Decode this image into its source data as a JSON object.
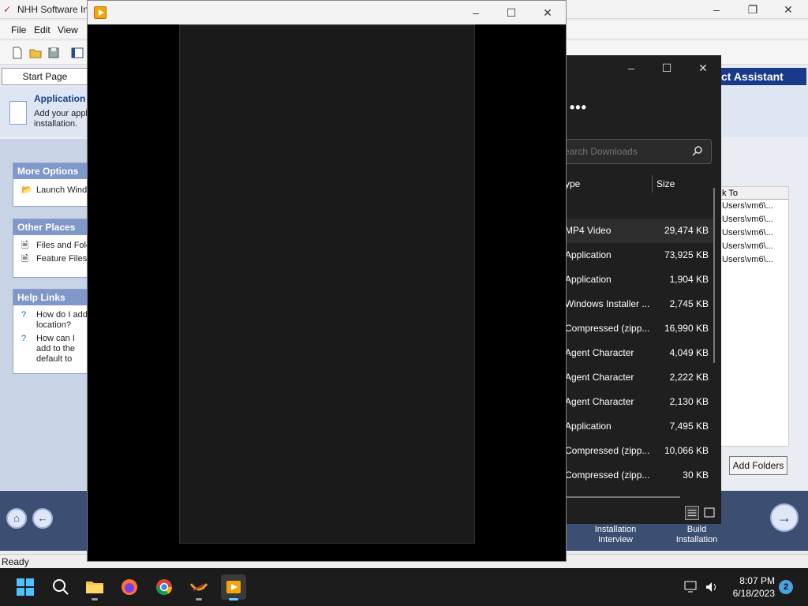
{
  "installer": {
    "title": "NHH Software In",
    "menu": [
      "File",
      "Edit",
      "View"
    ],
    "start_page_tab": "Start Page",
    "heading": "Application",
    "description": "Add your appl installation.",
    "right_title": "ct Assistant",
    "more_options": {
      "title": "More Options",
      "items": [
        "Launch Windo"
      ]
    },
    "other_places": {
      "title": "Other Places",
      "items": [
        "Files and Fold",
        "Feature Files"
      ]
    },
    "help_links": {
      "title": "Help Links",
      "items": [
        "How do I add location?",
        "How can I add to the default to me?"
      ]
    },
    "list": {
      "column": "k To",
      "rows": [
        "Users\\vm6\\...",
        "Users\\vm6\\...",
        "Users\\vm6\\...",
        "Users\\vm6\\...",
        "Users\\vm6\\..."
      ]
    },
    "add_folders": "Add Folders",
    "nav": {
      "installation_interview": "Installation Interview",
      "build_installation": "Build Installation"
    },
    "status": "Ready"
  },
  "explorer": {
    "more_label": "•••",
    "search_placeholder": "earch Downloads",
    "columns": {
      "type": "ype",
      "size": "Size"
    },
    "files": [
      {
        "type": "MP4 Video",
        "size": "29,474 KB",
        "selected": true
      },
      {
        "type": "Application",
        "size": "73,925 KB"
      },
      {
        "type": "Application",
        "size": "1,904 KB"
      },
      {
        "type": "Windows Installer ...",
        "size": "2,745 KB"
      },
      {
        "type": "Compressed (zipp...",
        "size": "16,990 KB"
      },
      {
        "type": "Agent Character",
        "size": "4,049 KB"
      },
      {
        "type": "Agent Character",
        "size": "2,222 KB"
      },
      {
        "type": "Agent Character",
        "size": "2,130 KB"
      },
      {
        "type": "Application",
        "size": "7,495 KB"
      },
      {
        "type": "Compressed (zipp...",
        "size": "10,066 KB"
      },
      {
        "type": "Compressed (zipp...",
        "size": "30 KB"
      }
    ]
  },
  "player": {
    "icon": "media-player-icon"
  },
  "taskbar": {
    "apps": [
      "start-icon",
      "search-icon",
      "file-explorer-icon",
      "firefox-icon",
      "chrome-icon",
      "agent-app-icon",
      "media-player-icon"
    ],
    "time": "8:07 PM",
    "date": "6/18/2023",
    "notifications": "2"
  },
  "colors": {
    "accent": "#60cdff",
    "installer_title": "#173a8a",
    "explorer_bg": "#1f1f1f"
  }
}
